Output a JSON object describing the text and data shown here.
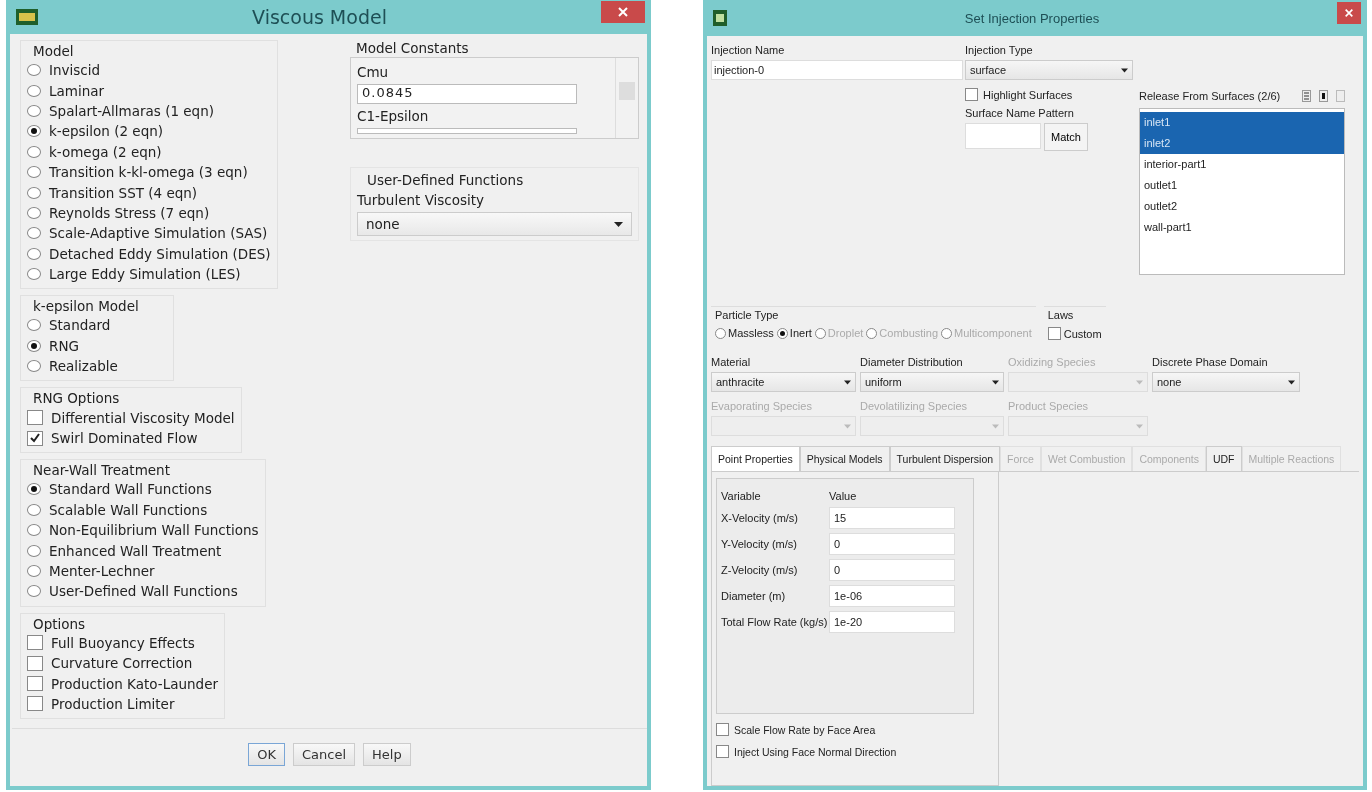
{
  "left": {
    "title": "Viscous Model",
    "model": {
      "label": "Model",
      "options": [
        {
          "label": "Inviscid",
          "selected": false
        },
        {
          "label": "Laminar",
          "selected": false
        },
        {
          "label": "Spalart-Allmaras (1 eqn)",
          "selected": false
        },
        {
          "label": "k-epsilon (2 eqn)",
          "selected": true
        },
        {
          "label": "k-omega (2 eqn)",
          "selected": false
        },
        {
          "label": "Transition k-kl-omega (3 eqn)",
          "selected": false
        },
        {
          "label": "Transition SST (4 eqn)",
          "selected": false
        },
        {
          "label": "Reynolds Stress (7 eqn)",
          "selected": false
        },
        {
          "label": "Scale-Adaptive Simulation (SAS)",
          "selected": false
        },
        {
          "label": "Detached Eddy Simulation (DES)",
          "selected": false
        },
        {
          "label": "Large Eddy Simulation (LES)",
          "selected": false
        }
      ]
    },
    "constants": {
      "label": "Model Constants",
      "items": [
        {
          "name": "Cmu",
          "value": "0.0845"
        },
        {
          "name": "C1-Epsilon"
        }
      ]
    },
    "udf": {
      "label": "User-Defined Functions",
      "field_label": "Turbulent Viscosity",
      "value": "none"
    },
    "k_epsilon": {
      "label": "k-epsilon Model",
      "options": [
        {
          "label": "Standard",
          "selected": false
        },
        {
          "label": "RNG",
          "selected": true
        },
        {
          "label": "Realizable",
          "selected": false
        }
      ]
    },
    "rng_options": {
      "label": "RNG Options",
      "options": [
        {
          "label": "Differential Viscosity Model",
          "checked": false
        },
        {
          "label": "Swirl Dominated Flow",
          "checked": true
        }
      ]
    },
    "near_wall": {
      "label": "Near-Wall Treatment",
      "options": [
        {
          "label": "Standard Wall Functions",
          "selected": true
        },
        {
          "label": "Scalable Wall Functions",
          "selected": false
        },
        {
          "label": "Non-Equilibrium Wall Functions",
          "selected": false
        },
        {
          "label": "Enhanced Wall Treatment",
          "selected": false
        },
        {
          "label": "Menter-Lechner",
          "selected": false
        },
        {
          "label": "User-Defined Wall Functions",
          "selected": false
        }
      ]
    },
    "options": {
      "label": "Options",
      "options": [
        {
          "label": "Full Buoyancy Effects",
          "checked": false
        },
        {
          "label": "Curvature Correction",
          "checked": false
        },
        {
          "label": "Production Kato-Launder",
          "checked": false
        },
        {
          "label": "Production Limiter",
          "checked": false
        }
      ]
    },
    "buttons": [
      {
        "label": "OK",
        "default": true
      },
      {
        "label": "Cancel",
        "default": false
      },
      {
        "label": "Help",
        "default": false
      }
    ]
  },
  "right": {
    "title": "Set Injection Properties",
    "injection_name": {
      "label": "Injection Name",
      "value": "injection-0"
    },
    "injection_type": {
      "label": "Injection Type",
      "value": "surface"
    },
    "highlight_surfaces": {
      "label": "Highlight Surfaces",
      "checked": false
    },
    "surface_name_pattern": {
      "label": "Surface Name Pattern",
      "button": "Match"
    },
    "release": {
      "label": "Release From Surfaces (2/6)",
      "items": [
        {
          "label": "inlet1",
          "selected": true
        },
        {
          "label": "inlet2",
          "selected": true
        },
        {
          "label": "interior-part1",
          "selected": false
        },
        {
          "label": "outlet1",
          "selected": false
        },
        {
          "label": "outlet2",
          "selected": false
        },
        {
          "label": "wall-part1",
          "selected": false
        }
      ]
    },
    "particle_type": {
      "label": "Particle Type",
      "options": [
        {
          "label": "Massless",
          "selected": false,
          "disabled": false
        },
        {
          "label": "Inert",
          "selected": true,
          "disabled": false
        },
        {
          "label": "Droplet",
          "selected": false,
          "disabled": true
        },
        {
          "label": "Combusting",
          "selected": false,
          "disabled": true
        },
        {
          "label": "Multicomponent",
          "selected": false,
          "disabled": true
        }
      ]
    },
    "laws": {
      "label": "Laws",
      "options": [
        {
          "label": "Custom",
          "checked": false
        }
      ]
    },
    "selectors": [
      {
        "label": "Material",
        "value": "anthracite",
        "disabled": false
      },
      {
        "label": "Diameter Distribution",
        "value": "uniform",
        "disabled": false
      },
      {
        "label": "Oxidizing Species",
        "disabled": true
      },
      {
        "label": "Discrete Phase Domain",
        "value": "none",
        "disabled": false
      },
      {
        "label": "Evaporating Species",
        "disabled": true
      },
      {
        "label": "Devolatilizing Species",
        "disabled": true
      },
      {
        "label": "Product Species",
        "disabled": true
      }
    ],
    "tabs": [
      {
        "label": "Point Properties",
        "selected": true,
        "disabled": false
      },
      {
        "label": "Physical Models",
        "selected": false,
        "disabled": false
      },
      {
        "label": "Turbulent Dispersion",
        "selected": false,
        "disabled": false
      },
      {
        "label": "Force",
        "selected": false,
        "disabled": true
      },
      {
        "label": "Wet Combustion",
        "selected": false,
        "disabled": true
      },
      {
        "label": "Components",
        "selected": false,
        "disabled": true
      },
      {
        "label": "UDF",
        "selected": false,
        "disabled": false
      },
      {
        "label": "Multiple Reactions",
        "selected": false,
        "disabled": true
      }
    ],
    "properties": {
      "columns": [
        "Variable",
        "Value"
      ],
      "rows": [
        {
          "label": "X-Velocity (m/s)",
          "value": "15"
        },
        {
          "label": "Y-Velocity (m/s)",
          "value": "0"
        },
        {
          "label": "Z-Velocity (m/s)",
          "value": "0"
        },
        {
          "label": "Diameter (m)",
          "value": "1e-06"
        },
        {
          "label": "Total Flow Rate (kg/s)",
          "value": "1e-20"
        }
      ]
    },
    "bottom_options": [
      {
        "label": "Scale Flow Rate by Face Area",
        "checked": false
      },
      {
        "label": "Inject Using Face Normal Direction",
        "checked": false
      }
    ]
  }
}
